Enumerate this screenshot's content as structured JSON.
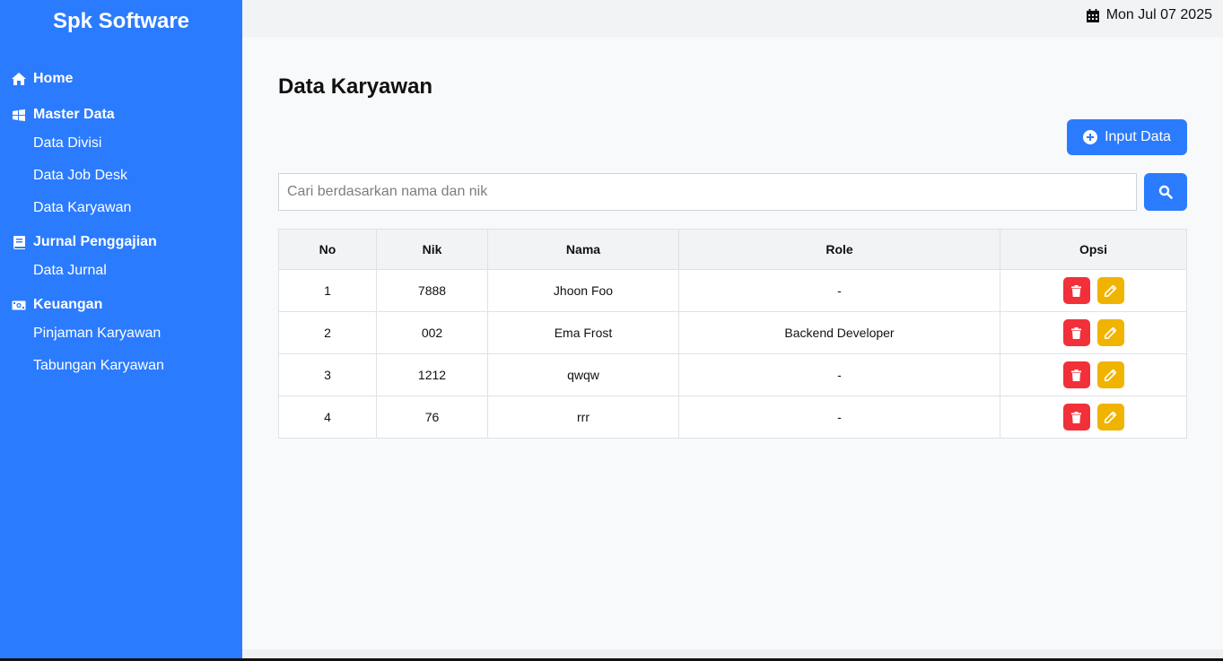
{
  "brand": "Spk Software",
  "date": "Mon Jul 07 2025",
  "nav": {
    "home": "Home",
    "master": {
      "label": "Master Data",
      "items": [
        "Data Divisi",
        "Data Job Desk",
        "Data Karyawan"
      ]
    },
    "jurnal": {
      "label": "Jurnal Penggajian",
      "items": [
        "Data Jurnal"
      ]
    },
    "keuangan": {
      "label": "Keuangan",
      "items": [
        "Pinjaman Karyawan",
        "Tabungan Karyawan"
      ]
    }
  },
  "page": {
    "title": "Data Karyawan",
    "input_button": "Input Data",
    "search_placeholder": "Cari berdasarkan nama dan nik"
  },
  "table": {
    "headers": [
      "No",
      "Nik",
      "Nama",
      "Role",
      "Opsi"
    ],
    "rows": [
      {
        "no": "1",
        "nik": "7888",
        "nama": "Jhoon Foo",
        "role": "-"
      },
      {
        "no": "2",
        "nik": "002",
        "nama": "Ema Frost",
        "role": "Backend Developer"
      },
      {
        "no": "3",
        "nik": "1212",
        "nama": "qwqw",
        "role": "-"
      },
      {
        "no": "4",
        "nik": "76",
        "nama": "rrr",
        "role": "-"
      }
    ]
  },
  "colors": {
    "primary": "#2b7bfe",
    "danger": "#f2303a",
    "warning": "#f0b400"
  },
  "icons": {
    "home": "home-icon",
    "master": "windows-icon",
    "jurnal": "book-icon",
    "keuangan": "money-icon",
    "date": "calendar-icon",
    "input": "plus-circle-icon",
    "search": "search-icon",
    "delete": "trash-icon",
    "edit": "pencil-icon"
  }
}
